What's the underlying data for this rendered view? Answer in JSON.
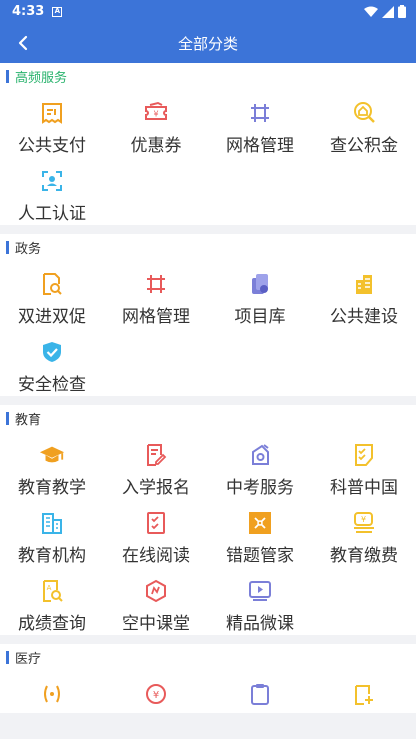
{
  "status_bar": {
    "time": "4:33",
    "notif_icon": "A"
  },
  "app_bar": {
    "title": "全部分类",
    "back_icon": "back-arrow-icon"
  },
  "sections": [
    {
      "title": "高频服务",
      "items": [
        {
          "label": "公共支付",
          "icon": "receipt-icon"
        },
        {
          "label": "优惠券",
          "icon": "coupon-icon"
        },
        {
          "label": "网格管理",
          "icon": "grid-icon"
        },
        {
          "label": "查公积金",
          "icon": "fund-search-icon"
        },
        {
          "label": "人工认证",
          "icon": "face-scan-icon"
        }
      ]
    },
    {
      "title": "政务",
      "items": [
        {
          "label": "双进双促",
          "icon": "doc-search-icon"
        },
        {
          "label": "网格管理",
          "icon": "grid-icon"
        },
        {
          "label": "项目库",
          "icon": "project-icon"
        },
        {
          "label": "公共建设",
          "icon": "building-icon"
        },
        {
          "label": "安全检查",
          "icon": "shield-check-icon"
        }
      ]
    },
    {
      "title": "教育",
      "items": [
        {
          "label": "教育教学",
          "icon": "graduation-cap-icon"
        },
        {
          "label": "入学报名",
          "icon": "sign-up-icon"
        },
        {
          "label": "中考服务",
          "icon": "exam-icon"
        },
        {
          "label": "科普中国",
          "icon": "checklist-icon"
        },
        {
          "label": "教育机构",
          "icon": "institution-icon"
        },
        {
          "label": "在线阅读",
          "icon": "reading-icon"
        },
        {
          "label": "错题管家",
          "icon": "mistake-icon"
        },
        {
          "label": "教育缴费",
          "icon": "payment-icon"
        },
        {
          "label": "成绩查询",
          "icon": "score-search-icon"
        },
        {
          "label": "空中课堂",
          "icon": "sky-class-icon"
        },
        {
          "label": "精品微课",
          "icon": "video-class-icon"
        }
      ]
    },
    {
      "title": "医疗",
      "items": [
        {
          "label": "",
          "icon": "medical-1-icon"
        },
        {
          "label": "",
          "icon": "medical-2-icon"
        },
        {
          "label": "",
          "icon": "medical-3-icon"
        },
        {
          "label": "",
          "icon": "medical-4-icon"
        }
      ]
    }
  ],
  "colors": {
    "primary": "#3c74d8",
    "green": "#29b36d",
    "orange": "#f0a020",
    "red": "#e85a5a",
    "purple": "#7b7fd8",
    "cyan": "#3ab4e8",
    "yellow": "#f3c12c"
  }
}
